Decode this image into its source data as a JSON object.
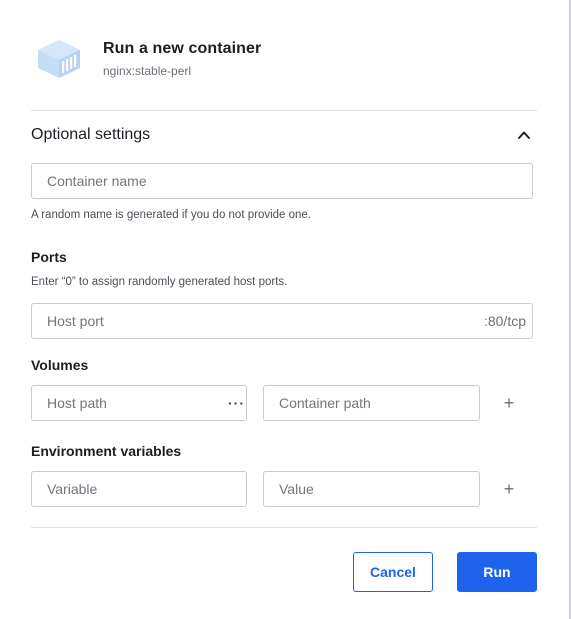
{
  "header": {
    "title": "Run a new container",
    "image": "nginx:stable-perl",
    "icon": "container-cube-icon"
  },
  "optional_settings": {
    "title": "Optional settings",
    "expanded": true,
    "container_name": {
      "placeholder": "Container name",
      "value": "",
      "helper": "A random name is generated if you do not provide one."
    },
    "ports": {
      "label": "Ports",
      "helper": "Enter “0” to assign randomly generated host ports.",
      "host_port_placeholder": "Host port",
      "host_port_value": "",
      "container_port": ":80/tcp"
    },
    "volumes": {
      "label": "Volumes",
      "host_path_placeholder": "Host path",
      "browse_label": "···",
      "container_path_placeholder": "Container path",
      "add_label": "+"
    },
    "environment": {
      "label": "Environment variables",
      "variable_placeholder": "Variable",
      "value_placeholder": "Value",
      "add_label": "+"
    }
  },
  "footer": {
    "cancel_label": "Cancel",
    "run_label": "Run"
  },
  "colors": {
    "accent": "#1d63ed",
    "icon": "#c6ddf6",
    "border": "#c9cdd2"
  }
}
